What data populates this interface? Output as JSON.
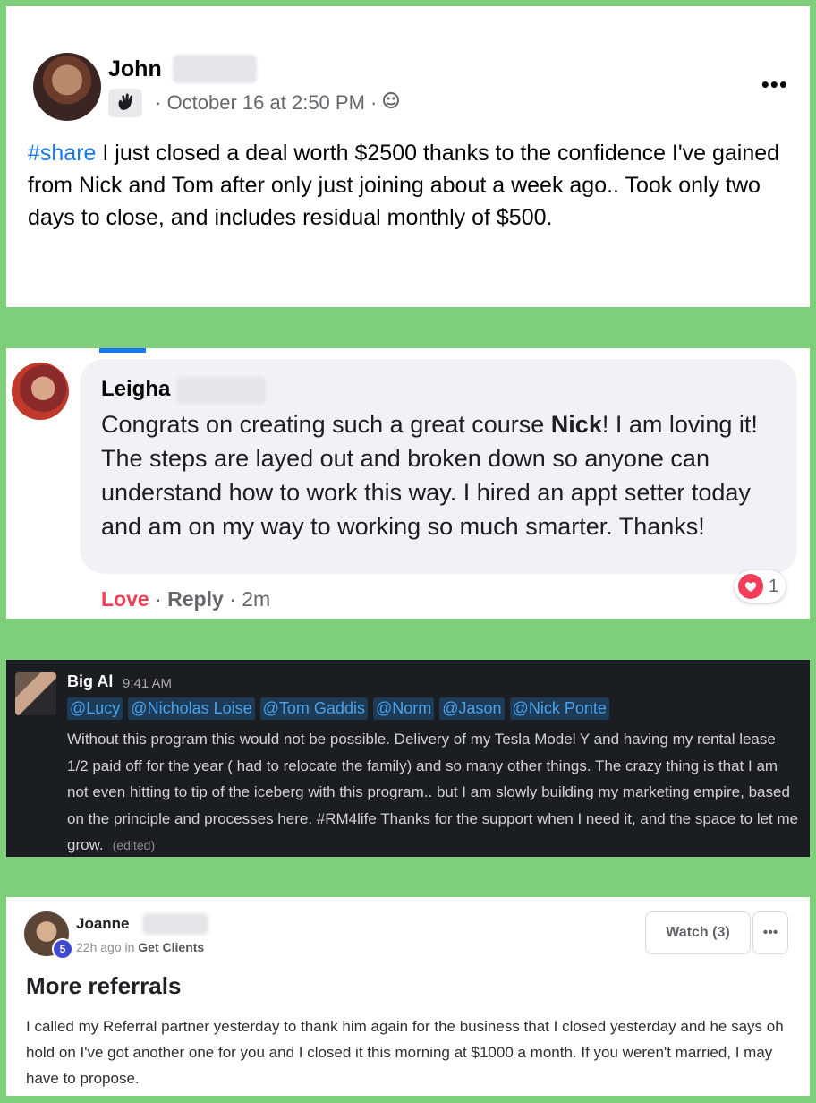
{
  "post1": {
    "author": "John",
    "timestamp": "October 16 at 2:50 PM",
    "audience_icon": "friends-globe-icon",
    "hashtag": "#share",
    "body": " I just closed a deal worth $2500 thanks to the confidence I've gained from Nick and Tom after only just joining about a week ago.. Took only two days to close, and includes residual monthly of $500.",
    "more_label": "•••"
  },
  "comment": {
    "author": "Leigha",
    "text_before": "Congrats on creating such a great course ",
    "text_bold": "Nick",
    "text_after": "! I am loving it! The steps are layed out and broken down so anyone can understand how to work this way. I hired an appt setter today and am on my way to working so much smarter. Thanks!",
    "love_label": "Love",
    "reply_label": "Reply",
    "age": "2m",
    "reaction_count": "1"
  },
  "slack": {
    "author": "Big Al",
    "time": "9:41 AM",
    "mentions": [
      "@Lucy",
      "@Nicholas Loise",
      "@Tom Gaddis",
      "@Norm",
      "@Jason",
      "@Nick Ponte"
    ],
    "body": "Without this program this would not be possible.  Delivery of my Tesla Model Y and having my rental lease 1/2 paid off for the year ( had to relocate the family) and so many other things. The crazy thing is that I am not even hitting to tip of the iceberg with this program..  but I am slowly building my marketing empire, based on the principle and processes here.  #RM4life Thanks for the support when I need it, and the space to let me grow.",
    "edited": "(edited)"
  },
  "post2": {
    "author": "Joanne",
    "level": "5",
    "age": "22h ago in",
    "category": "Get Clients",
    "watch_label": "Watch (3)",
    "more_label": "•••",
    "title": "More referrals",
    "body": "I called my Referral partner yesterday to thank him again for the business that I closed yesterday and he says oh hold on I've got another one for you and I closed it this morning at $1000 a month. If you weren't married, I may have to propose."
  },
  "colors": {
    "background": "#7fce7c",
    "facebook_blue": "#1877f2",
    "love_red": "#f33e58",
    "slack_bg": "#1a1d21",
    "slack_mention": "#4ba3e9"
  }
}
